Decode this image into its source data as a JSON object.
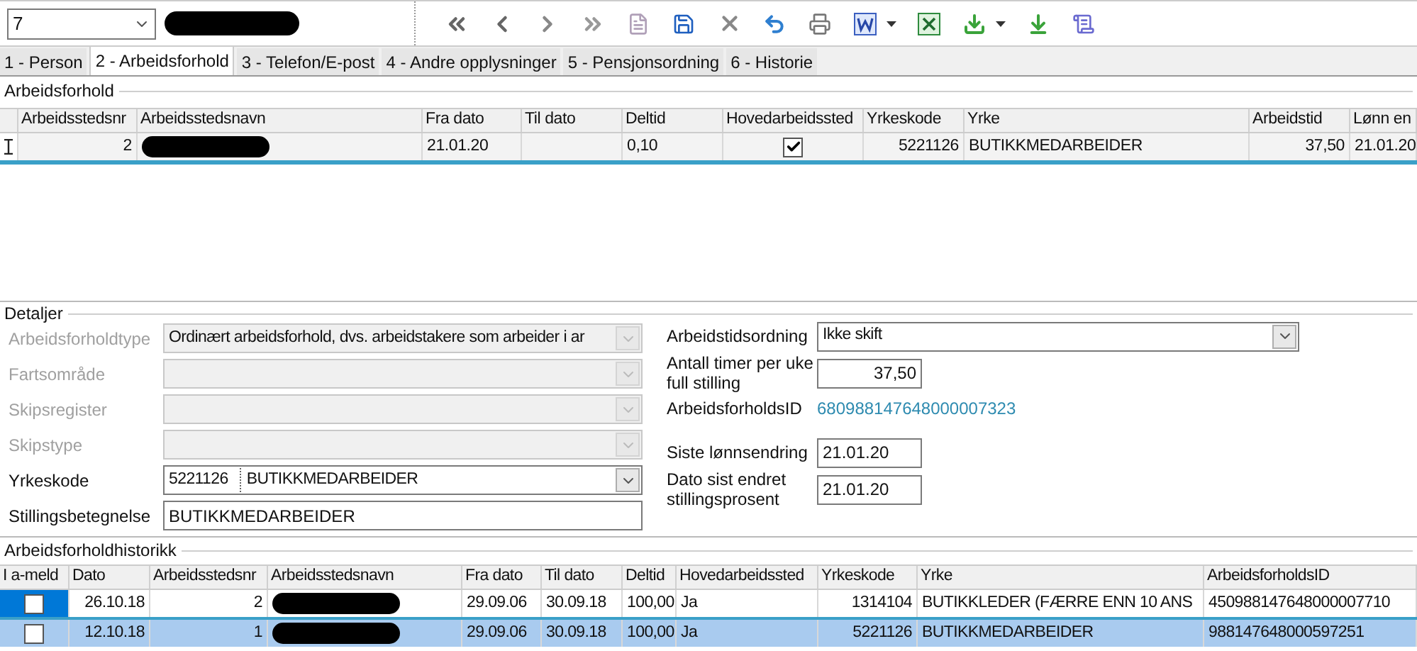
{
  "record_selector": {
    "value": "7"
  },
  "tabs": [
    {
      "label": "1 - Person",
      "selected": false
    },
    {
      "label": "2 - Arbeidsforhold",
      "selected": true
    },
    {
      "label": "3 - Telefon/E-post",
      "selected": false
    },
    {
      "label": "4 - Andre opplysninger",
      "selected": false
    },
    {
      "label": "5 - Pensjonsordning",
      "selected": false
    },
    {
      "label": "6 - Historie",
      "selected": false
    }
  ],
  "employment": {
    "title": "Arbeidsforhold",
    "columns": [
      "Arbeidsstedsnr",
      "Arbeidsstedsnavn",
      "Fra dato",
      "Til dato",
      "Deltid",
      "Hovedarbeidssted",
      "Yrkeskode",
      "Yrke",
      "Arbeidstid",
      "Lønn en"
    ],
    "rows": [
      {
        "current": true,
        "selected": false,
        "cells": [
          {
            "kind": "number",
            "text": "2"
          },
          {
            "kind": "redacted"
          },
          {
            "kind": "text",
            "text": "21.01.20"
          },
          {
            "kind": "empty"
          },
          {
            "kind": "text",
            "text": "0,10"
          },
          {
            "kind": "checkbox",
            "checked": true
          },
          {
            "kind": "number",
            "text": "5221126"
          },
          {
            "kind": "text",
            "text": "BUTIKKMEDARBEIDER"
          },
          {
            "kind": "number",
            "text": "37,50"
          },
          {
            "kind": "text",
            "text": "21.01.20"
          }
        ]
      }
    ]
  },
  "details": {
    "title": "Detaljer",
    "left": [
      {
        "label": "Arbeidsforholdtype",
        "kind": "combo",
        "value": "Ordinært arbeidsforhold, dvs. arbeidstakere som arbeider i ar",
        "disabled": true
      },
      {
        "label": "Fartsområde",
        "kind": "combo",
        "disabled": true
      },
      {
        "label": "Skipsregister",
        "kind": "combo",
        "disabled": true
      },
      {
        "label": "Skipstype",
        "kind": "combo",
        "disabled": true
      },
      {
        "label": "Yrkeskode",
        "kind": "combo",
        "value": "5221126",
        "description": "BUTIKKMEDARBEIDER",
        "disabled": false
      },
      {
        "label": "Stillingsbetegnelse",
        "kind": "text",
        "value": "BUTIKKMEDARBEIDER",
        "disabled": false
      }
    ],
    "right": [
      {
        "label": "Arbeidstidsordning",
        "kind": "combo",
        "value": "Ikke skift"
      },
      {
        "label": "Antall timer per uke full stilling",
        "kind": "number",
        "value": "37,50"
      },
      {
        "label": "ArbeidsforholdsID",
        "kind": "link",
        "value": "680988147648000007323"
      },
      {
        "label": "Siste lønnsendring",
        "kind": "text",
        "value": "21.01.20"
      },
      {
        "label": "Dato sist endret stillingsprosent",
        "kind": "text",
        "value": "21.01.20"
      }
    ]
  },
  "history": {
    "title": "Arbeidsforholdhistorikk",
    "columns": [
      "I a-meld",
      "Dato",
      "Arbeidsstedsnr",
      "Arbeidsstedsnavn",
      "Fra dato",
      "Til dato",
      "Deltid",
      "Hovedarbeidssted",
      "Yrkeskode",
      "Yrke",
      "ArbeidsforholdsID"
    ],
    "rows": [
      {
        "current": true,
        "selected": false,
        "cells": [
          {
            "kind": "checkbox",
            "checked": false
          },
          {
            "kind": "number",
            "text": "26.10.18"
          },
          {
            "kind": "number",
            "text": "2"
          },
          {
            "kind": "redacted"
          },
          {
            "kind": "text",
            "text": "29.09.06"
          },
          {
            "kind": "text",
            "text": "30.09.18"
          },
          {
            "kind": "text",
            "text": "100,00"
          },
          {
            "kind": "text",
            "text": "Ja"
          },
          {
            "kind": "number",
            "text": "1314104"
          },
          {
            "kind": "text",
            "text": "BUTIKKLEDER (FÆRRE ENN 10 ANS"
          },
          {
            "kind": "text",
            "text": "450988147648000007710"
          }
        ]
      },
      {
        "current": false,
        "selected": true,
        "cells": [
          {
            "kind": "checkbox",
            "checked": false
          },
          {
            "kind": "number",
            "text": "12.10.18"
          },
          {
            "kind": "number",
            "text": "1"
          },
          {
            "kind": "redacted"
          },
          {
            "kind": "text",
            "text": "29.09.06"
          },
          {
            "kind": "text",
            "text": "30.09.18"
          },
          {
            "kind": "text",
            "text": "100,00"
          },
          {
            "kind": "text",
            "text": "Ja"
          },
          {
            "kind": "number",
            "text": "5221126"
          },
          {
            "kind": "text",
            "text": "BUTIKKMEDARBEIDER"
          },
          {
            "kind": "text",
            "text": "988147648000597251"
          }
        ]
      }
    ]
  }
}
